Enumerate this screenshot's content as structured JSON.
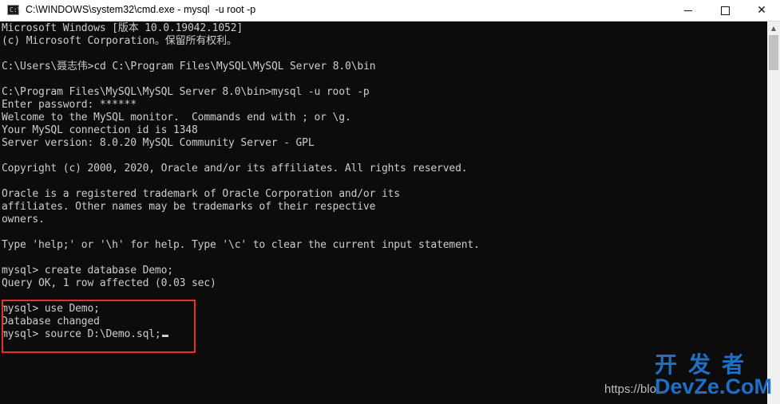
{
  "window": {
    "title": "C:\\WINDOWS\\system32\\cmd.exe - mysql  -u root -p",
    "icon_text": "C:\\"
  },
  "console": {
    "lines": [
      "Microsoft Windows [版本 10.0.19042.1052]",
      "(c) Microsoft Corporation。保留所有权利。",
      "",
      "C:\\Users\\聂志伟>cd C:\\Program Files\\MySQL\\MySQL Server 8.0\\bin",
      "",
      "C:\\Program Files\\MySQL\\MySQL Server 8.0\\bin>mysql -u root -p",
      "Enter password: ******",
      "Welcome to the MySQL monitor.  Commands end with ; or \\g.",
      "Your MySQL connection id is 1348",
      "Server version: 8.0.20 MySQL Community Server - GPL",
      "",
      "Copyright (c) 2000, 2020, Oracle and/or its affiliates. All rights reserved.",
      "",
      "Oracle is a registered trademark of Oracle Corporation and/or its",
      "affiliates. Other names may be trademarks of their respective",
      "owners.",
      "",
      "Type 'help;' or '\\h' for help. Type '\\c' to clear the current input statement.",
      "",
      "mysql> create database Demo;",
      "Query OK, 1 row affected (0.03 sec)",
      "",
      "mysql> use Demo;",
      "Database changed",
      "mysql> source D:\\Demo.sql;"
    ]
  },
  "watermark": {
    "chinese": "开发者",
    "english": "DevZe.CoM",
    "url": "https://blo"
  },
  "colors": {
    "console_bg": "#0c0c0c",
    "console_text": "#cccccc",
    "highlight_border": "#e8312a",
    "watermark": "#1f6fc4"
  }
}
